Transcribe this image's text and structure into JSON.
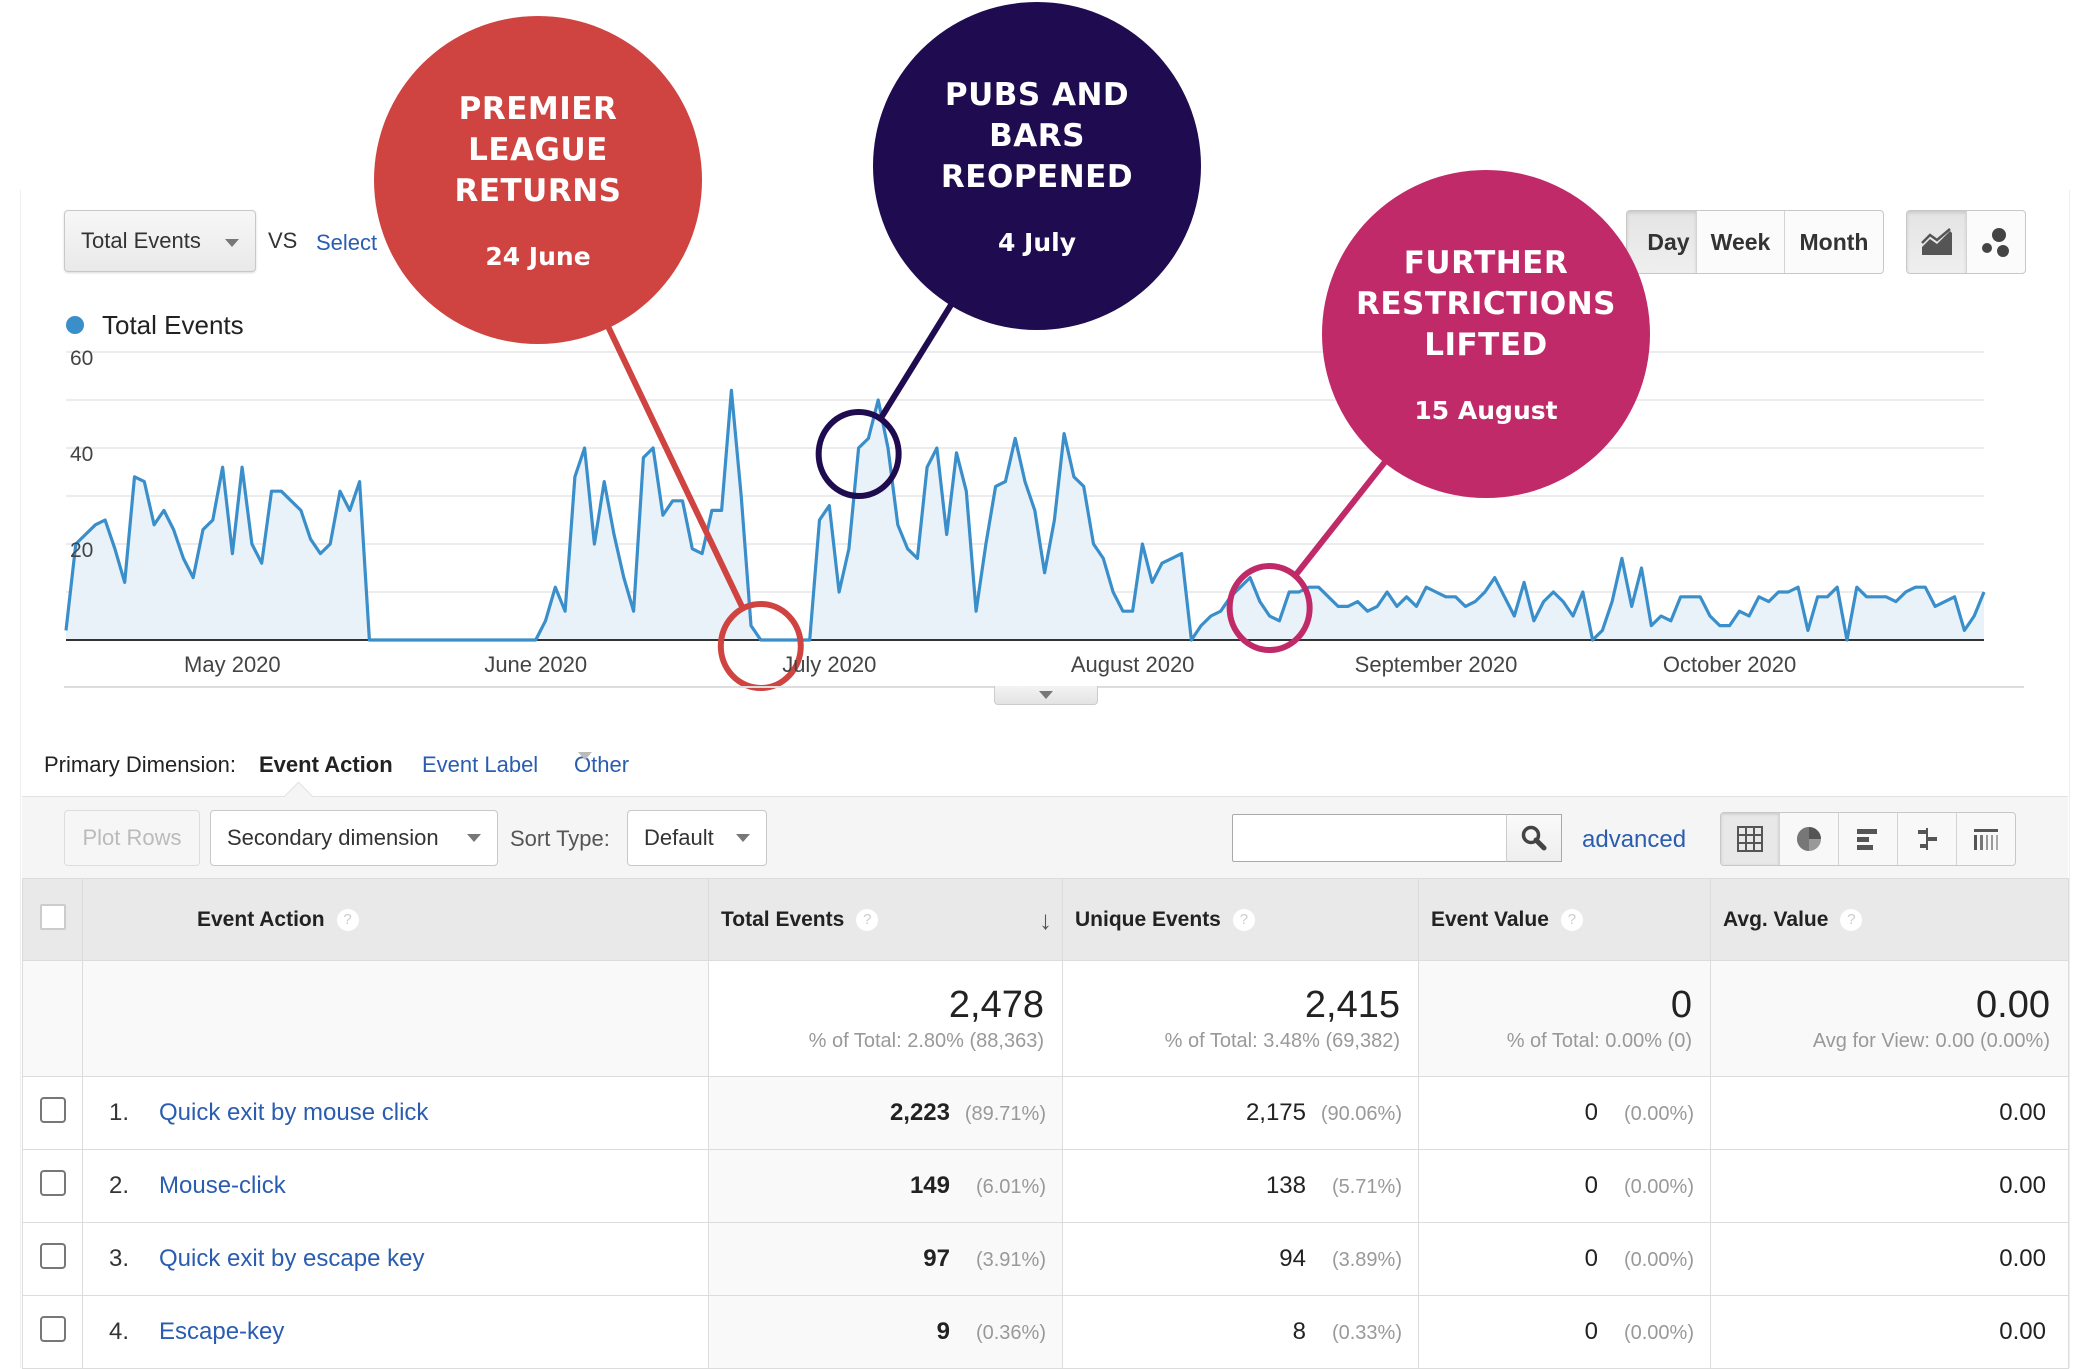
{
  "toolbar": {
    "metric_select": "Total Events",
    "vs_label": "VS",
    "select_metric_link": "Select",
    "granularity": [
      {
        "label": "Day",
        "active": true
      },
      {
        "label": "Week",
        "active": false
      },
      {
        "label": "Month",
        "active": false
      }
    ],
    "chart_type_buttons": [
      {
        "icon": "line-chart-icon",
        "active": true
      },
      {
        "icon": "motion-chart-icon",
        "active": false
      }
    ]
  },
  "chart_data": {
    "type": "area",
    "series": [
      {
        "name": "Total Events",
        "color": "#3a8fcb",
        "values": [
          2,
          20,
          22,
          24,
          25,
          19,
          12,
          34,
          33,
          24,
          27,
          23,
          17,
          13,
          23,
          25,
          36,
          18,
          36,
          20,
          16,
          31,
          31,
          29,
          27,
          21,
          18,
          20,
          31,
          27,
          33,
          0,
          0,
          0,
          0,
          0,
          0,
          0,
          0,
          0,
          0,
          0,
          0,
          0,
          0,
          0,
          0,
          0,
          0,
          4,
          11,
          6,
          34,
          40,
          20,
          33,
          22,
          13,
          6,
          38,
          40,
          26,
          29,
          29,
          19,
          18,
          27,
          27,
          52,
          30,
          3,
          0,
          0,
          0,
          0,
          0,
          0,
          25,
          28,
          10,
          19,
          40,
          42,
          50,
          40,
          24,
          19,
          17,
          36,
          40,
          22,
          39,
          31,
          6,
          20,
          32,
          33,
          42,
          33,
          27,
          14,
          25,
          43,
          34,
          32,
          20,
          17,
          10,
          6,
          6,
          20,
          12,
          16,
          17,
          18,
          0,
          3,
          5,
          6,
          9,
          11,
          13,
          8,
          5,
          4,
          10,
          10,
          11,
          11,
          9,
          7,
          7,
          8,
          6,
          7,
          10,
          7,
          9,
          7,
          11,
          10,
          9,
          9,
          7,
          8,
          10,
          13,
          9,
          5,
          12,
          4,
          8,
          10,
          8,
          5,
          10,
          0,
          2,
          8,
          17,
          7,
          15,
          3,
          5,
          4,
          9,
          9,
          9,
          5,
          3,
          3,
          6,
          5,
          9,
          8,
          10,
          10,
          11,
          2,
          9,
          9,
          11,
          0,
          11,
          9,
          9,
          9,
          8,
          10,
          11,
          11,
          7,
          8,
          9,
          2,
          5,
          10
        ]
      }
    ],
    "x_start": "2020-04-14",
    "x_tick_labels": [
      "May 2020",
      "June 2020",
      "July 2020",
      "August 2020",
      "September 2020",
      "October 2020"
    ],
    "x_tick_dates": [
      "2020-05-01",
      "2020-06-01",
      "2020-07-01",
      "2020-08-01",
      "2020-09-01",
      "2020-10-01"
    ],
    "y_tick_labels": [
      "20",
      "40",
      "60"
    ],
    "y_ticks": [
      20,
      40,
      60
    ],
    "ylim": [
      0,
      60
    ],
    "grid": true,
    "gridline_step": 10,
    "legend": "top-left",
    "title": "",
    "xlabel": "",
    "ylabel": "",
    "annotations": [
      {
        "title_lines": [
          "PREMIER",
          "LEAGUE",
          "RETURNS"
        ],
        "date_label": "24 June",
        "target_date": "2020-06-24",
        "color": "#cf4340"
      },
      {
        "title_lines": [
          "PUBS AND",
          "BARS",
          "REOPENED"
        ],
        "date_label": "4 July",
        "target_date": "2020-07-04",
        "color": "#1f0b4f"
      },
      {
        "title_lines": [
          "FURTHER",
          "RESTRICTIONS",
          "LIFTED"
        ],
        "date_label": "15 August",
        "target_date": "2020-08-15",
        "color": "#c02a69"
      }
    ]
  },
  "legend": {
    "label": "Total Events",
    "color": "#3a8fcb"
  },
  "dimension_bar": {
    "label": "Primary Dimension:",
    "active": "Event Action",
    "options": [
      "Event Label",
      "Other"
    ]
  },
  "table_toolbar": {
    "plot_rows": "Plot Rows",
    "secondary_dimension": "Secondary dimension",
    "sort_type_label": "Sort Type:",
    "sort_type_value": "Default",
    "search_value": "",
    "search_placeholder": "",
    "advanced_link": "advanced",
    "view_buttons": [
      "table-view-icon",
      "pie-view-icon",
      "performance-view-icon",
      "comparison-view-icon",
      "term-cloud-icon"
    ]
  },
  "table": {
    "headers": [
      "Event Action",
      "Total Events",
      "Unique Events",
      "Event Value",
      "Avg. Value"
    ],
    "help_glyph": "?",
    "sort_arrow": "↓",
    "totals": {
      "total_events": {
        "value": "2,478",
        "sub": "% of Total: 2.80% (88,363)"
      },
      "unique_events": {
        "value": "2,415",
        "sub": "% of Total: 3.48% (69,382)"
      },
      "event_value": {
        "value": "0",
        "sub": "% of Total: 0.00% (0)"
      },
      "avg_value": {
        "value": "0.00",
        "sub": "Avg for View: 0.00 (0.00%)"
      }
    },
    "rows": [
      {
        "rank": "1.",
        "action": "Quick exit by mouse click",
        "total": "2,223",
        "total_pct": "(89.71%)",
        "unique": "2,175",
        "unique_pct": "(90.06%)",
        "value": "0",
        "value_pct": "(0.00%)",
        "avg": "0.00"
      },
      {
        "rank": "2.",
        "action": "Mouse-click",
        "total": "149",
        "total_pct": "(6.01%)",
        "unique": "138",
        "unique_pct": "(5.71%)",
        "value": "0",
        "value_pct": "(0.00%)",
        "avg": "0.00"
      },
      {
        "rank": "3.",
        "action": "Quick exit by escape key",
        "total": "97",
        "total_pct": "(3.91%)",
        "unique": "94",
        "unique_pct": "(3.89%)",
        "value": "0",
        "value_pct": "(0.00%)",
        "avg": "0.00"
      },
      {
        "rank": "4.",
        "action": "Escape-key",
        "total": "9",
        "total_pct": "(0.36%)",
        "unique": "8",
        "unique_pct": "(0.33%)",
        "value": "0",
        "value_pct": "(0.00%)",
        "avg": "0.00"
      }
    ]
  }
}
